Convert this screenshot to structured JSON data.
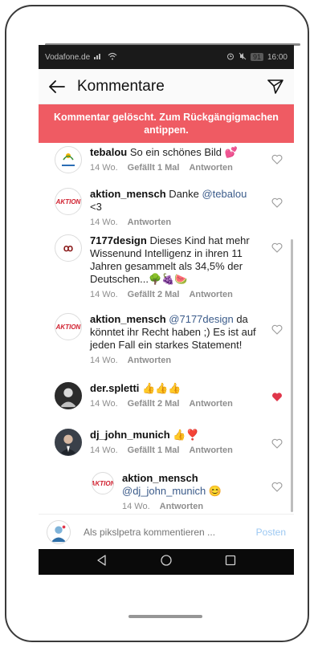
{
  "status_bar": {
    "carrier": "Vodafone.de",
    "battery": "91",
    "time": "16:00"
  },
  "header": {
    "title": "Kommentare"
  },
  "banner": {
    "text": "Kommentar gelöscht. Zum Rückgängigmachen antippen."
  },
  "comments": [
    {
      "user": "tebalou",
      "text": "So ein schönes Bild 💕",
      "time": "14 Wo.",
      "likes": "Gefällt 1 Mal",
      "reply": "Antworten",
      "liked": false
    },
    {
      "user": "aktion_mensch",
      "text_before": "Danke ",
      "mention": "@tebalou",
      "text_after": " <3",
      "time": "14 Wo.",
      "reply": "Antworten",
      "liked": false
    },
    {
      "user": "7177design",
      "text": "Dieses Kind hat mehr Wissenund Intelligenz in ihren 11 Jahren gesammelt als 34,5% der Deutschen...🌳🍇🍉",
      "time": "14 Wo.",
      "likes": "Gefällt 2 Mal",
      "reply": "Antworten",
      "liked": false
    },
    {
      "user": "aktion_mensch",
      "mention": "@7177design",
      "text_after": " da könntet ihr Recht haben ;) Es ist auf jeden Fall ein starkes Statement!",
      "time": "14 Wo.",
      "reply": "Antworten",
      "liked": false
    },
    {
      "user": "der.spletti",
      "text": "👍👍👍",
      "time": "14 Wo.",
      "likes": "Gefällt 2 Mal",
      "reply": "Antworten",
      "liked": true
    },
    {
      "user": "dj_john_munich",
      "text": "👍❣️",
      "time": "14 Wo.",
      "likes": "Gefällt 1 Mal",
      "reply": "Antworten",
      "liked": false
    },
    {
      "user": "aktion_mensch",
      "mention": "@dj_john_munich",
      "text_after": " 😊",
      "time": "14 Wo.",
      "reply": "Antworten",
      "liked": false
    }
  ],
  "composer": {
    "placeholder": "Als pikslpetra kommentieren ...",
    "post_label": "Posten"
  },
  "avatar_labels": {
    "aktion": "AKTION",
    "design": "ꝏ"
  },
  "colors": {
    "banner": "#ef5b63",
    "heart_liked": "#e0364a",
    "mention": "#3b5b8a",
    "post": "#9cc8f2"
  }
}
